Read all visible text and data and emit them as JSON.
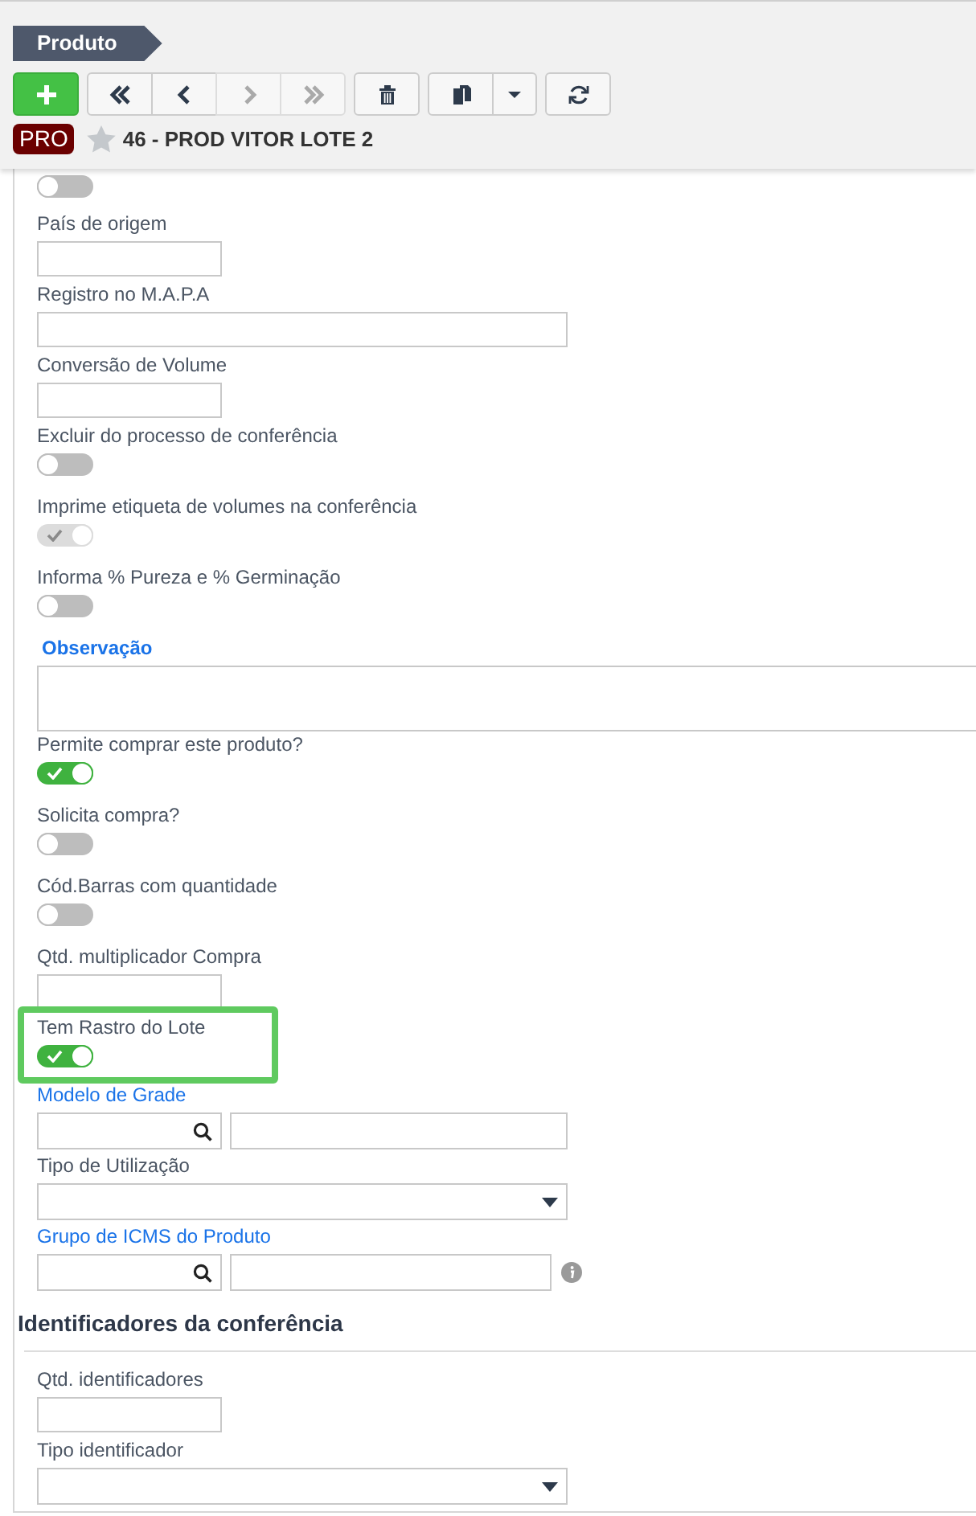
{
  "header": {
    "title": "Produto",
    "toolbar": [
      {
        "kind": "add",
        "disabled": false
      },
      {
        "kind": "first",
        "disabled": false
      },
      {
        "kind": "prev",
        "disabled": false
      },
      {
        "kind": "next",
        "disabled": true
      },
      {
        "kind": "last",
        "disabled": true
      },
      {
        "kind": "delete",
        "disabled": false
      },
      {
        "kind": "copy",
        "disabled": false
      },
      {
        "kind": "menu",
        "disabled": false
      },
      {
        "kind": "refresh",
        "disabled": false
      }
    ],
    "badge": "PRO",
    "favorite": false,
    "record": "46 - PROD VITOR LOTE 2"
  },
  "fields": [
    {
      "kind": "toggle",
      "on": false,
      "disabled": false,
      "highlighted": false
    },
    {
      "kind": "text_small",
      "label": "País de origem",
      "link": false,
      "highlighted": false
    },
    {
      "kind": "text_wide",
      "label": "Registro no M.A.P.A",
      "link": false,
      "highlighted": false
    },
    {
      "kind": "text_small",
      "label": "Conversão de Volume",
      "link": false,
      "highlighted": false
    },
    {
      "kind": "toggle",
      "label": "Excluir do processo de conferência",
      "link": false,
      "on": false,
      "disabled": false,
      "highlighted": false
    },
    {
      "kind": "toggle",
      "label": "Imprime etiqueta de volumes na conferência",
      "link": false,
      "on": true,
      "disabled": true,
      "highlighted": false
    },
    {
      "kind": "toggle",
      "label": "Informa % Pureza e % Germinação",
      "link": false,
      "on": false,
      "disabled": false,
      "highlighted": false
    },
    {
      "kind": "textarea",
      "label": "Observação",
      "link": true,
      "highlighted": false
    },
    {
      "kind": "toggle",
      "label": "Permite comprar este produto?",
      "link": false,
      "on": true,
      "disabled": false,
      "highlighted": false
    },
    {
      "kind": "toggle",
      "label": "Solicita compra?",
      "link": false,
      "on": false,
      "disabled": false,
      "highlighted": false
    },
    {
      "kind": "toggle",
      "label": "Cód.Barras com quantidade",
      "link": false,
      "on": false,
      "disabled": false,
      "highlighted": false
    },
    {
      "kind": "text_small",
      "label": "Qtd. multiplicador Compra",
      "link": false,
      "highlighted": false
    },
    {
      "kind": "toggle",
      "label": "Tem Rastro do Lote",
      "link": false,
      "on": true,
      "disabled": false,
      "highlighted": true
    },
    {
      "kind": "lookup",
      "label": "Modelo de Grade",
      "link": true,
      "info": false,
      "highlighted": false
    },
    {
      "kind": "select",
      "label": "Tipo de Utilização",
      "link": false,
      "highlighted": false
    },
    {
      "kind": "lookup",
      "label": "Grupo de ICMS do Produto",
      "link": true,
      "info": true,
      "highlighted": false
    },
    {
      "kind": "heading",
      "label": "Identificadores da conferência"
    },
    {
      "kind": "text_small",
      "label": "Qtd. identificadores",
      "link": false,
      "highlighted": false
    },
    {
      "kind": "select",
      "label": "Tipo identificador",
      "link": false,
      "highlighted": false
    }
  ]
}
